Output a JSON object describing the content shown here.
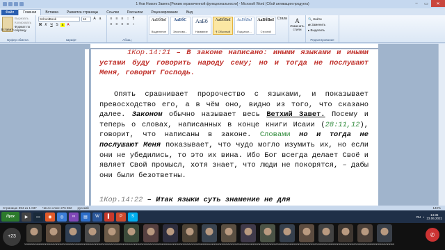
{
  "window": {
    "title": "1 Нов Нового Завета [Режим ограниченной функциональности] - Microsoft Word (Сбой активации продукта)"
  },
  "ribbon": {
    "tabs": [
      "Файл",
      "Главная",
      "Вставка",
      "Разметка страницы",
      "Ссылки",
      "Рассылки",
      "Рецензирование",
      "Вид"
    ],
    "clipboard": {
      "paste_label": "Вставить",
      "cut_label": "Вырезать",
      "copy_label": "Копировать",
      "format_label": "Формат по образцу",
      "group_label": "Буфер обмена"
    },
    "font": {
      "font_name": "SchoolBook",
      "font_size": "16",
      "group_label": "Шрифт"
    },
    "paragraph": {
      "group_label": "Абзац"
    },
    "styles": {
      "items": [
        {
          "sample": "АаБбВвI",
          "name": "Выделение"
        },
        {
          "sample": "АаБбС",
          "name": "Заголово..."
        },
        {
          "sample": "АаБб",
          "name": "Название"
        },
        {
          "sample": "АаБбВвI",
          "name": "¶ Обычный"
        },
        {
          "sample": "АаБбВвI",
          "name": "Подзагол..."
        },
        {
          "sample": "АаБбВвI",
          "name": "Строгий"
        }
      ],
      "change_label": "Изменить стили",
      "group_label": "Стили"
    },
    "editing": {
      "find_label": "Найти",
      "replace_label": "Заменить",
      "select_label": "Выделить",
      "group_label": "Редактирование"
    }
  },
  "document": {
    "p1": {
      "ref": "1Кор.14:21",
      "text": " – В законе написано: иными языками и иными устами буду говорить народу сему; но и тогда не послушают Меня, говорит Господь."
    },
    "p2": {
      "t1": "Опять сравнивает пророчество с языками, и показывает превосходство его, а в чём оно, видно из того, что сказано далее. ",
      "b1": "Законом",
      "t2": " обычно называет весь ",
      "b2": "Ветхий Завет.",
      "t3": " Посему и теперь о словах, написанных в конце книги Исаии (",
      "ref": "28:11,12",
      "t4": "), говорит, что написаны в законе. ",
      "g1": "Словами",
      "b3": " но и тогда не послушают Меня",
      "t5": " показывает, что чудо могло изумить их, но если они не убедились, то это их вина. Ибо Бог всегда делает Своё и являет Свой промысл, хотя знает, что люди не покорятся, – дабы они были безответны."
    },
    "p3": {
      "ref": "1Кор.14:22",
      "text": " – Итак языки суть знамение не для"
    }
  },
  "statusbar": {
    "page": "Страница: 894 из 1 037",
    "words": "Число слов: 276 862",
    "lang": "русский",
    "zoom": "140%"
  },
  "taskbar": {
    "start_label": "Пуск",
    "lang": "RU",
    "time": "14:35",
    "date": "23.06.2021"
  },
  "participants": {
    "count": "+23",
    "names": [
      "%%%%%%%%%%",
      "%%%%%%%%%%",
      "%%%%%%%%%%",
      "%%%%%%%%%%",
      "%%%%%%%%%%",
      "%%%%%%%%%%",
      "%%%%%%%%%%",
      "%%%%%%%%%%",
      "%%%%%%%%%%",
      "%%%%%%%%%%",
      "%%%%%%%%%%",
      "%%%%%%%%%%",
      "%%%%%%%%%%",
      "%%%%%%%%%%",
      "%%%%%%%%%%",
      "%%%%%%%%%%",
      "%%%%%%%%%%",
      "%%%%%%%%%%",
      "%%%%%%%%%%"
    ]
  }
}
